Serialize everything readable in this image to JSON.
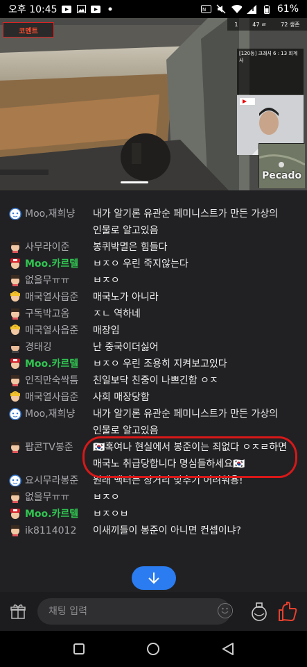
{
  "status_bar": {
    "time": "오후 10:45",
    "battery": "61%"
  },
  "video": {
    "channel_logo": "코멘트",
    "minimap_label": "Pecado",
    "info_panel_text": "[120등] 크래셔 6 : 13 회계사",
    "hud_labels": [
      "1",
      "47 ㄹ",
      "72 생존"
    ]
  },
  "chat": {
    "messages": [
      {
        "avatar": "blue-cat",
        "nick": "Moo,재희냥",
        "highlight": false,
        "text": "내가 알기론 유관순 페미니스트가 만든 가상의 인물로 알고있음"
      },
      {
        "avatar": "face",
        "nick": "사무라이준",
        "highlight": false,
        "text": "봉퀴박멸은 힘들다"
      },
      {
        "avatar": "red-hat",
        "nick": "Moo.카르텔",
        "highlight": true,
        "text": "ㅂㅈㅇ 우린 죽지않는다"
      },
      {
        "avatar": "face",
        "nick": "없을무ㅠㅠ",
        "highlight": false,
        "text": "ㅂㅈㅇ"
      },
      {
        "avatar": "blond",
        "nick": "매국열사읍준",
        "highlight": false,
        "text": "매국노가 아니라"
      },
      {
        "avatar": "face",
        "nick": "구독박고옴",
        "highlight": false,
        "text": "ㅈㄴ 역하네"
      },
      {
        "avatar": "blond",
        "nick": "매국열사읍준",
        "highlight": false,
        "text": "매장임"
      },
      {
        "avatar": "dark",
        "nick": "경태깅",
        "highlight": false,
        "text": "난 중국이더싫어"
      },
      {
        "avatar": "red-hat",
        "nick": "Moo.카르텔",
        "highlight": true,
        "text": "ㅂㅈㅇ 우린 조용히 지켜보고있다"
      },
      {
        "avatar": "face",
        "nick": "인직만숙싹틈",
        "highlight": false,
        "text": "친일보닥 친중이 나쁘긴함 ㅇㅈ"
      },
      {
        "avatar": "blond",
        "nick": "매국열사읍준",
        "highlight": false,
        "text": "사회 매장당함"
      },
      {
        "avatar": "blue-cat",
        "nick": "Moo,재희냥",
        "highlight": false,
        "text": "내가 알기론 유관순 페미니스트가 만든 가상의 인물로 알고있음"
      },
      {
        "avatar": "face",
        "nick": "팝콘TV봉준",
        "highlight": false,
        "text": "🇰🇷혹여나 현실에서 봉준이는 죄없다 ㅇㅈㄹ하면 매국노 취급당합니다 명심들하세요🇰🇷"
      },
      {
        "avatar": "blue-cat",
        "nick": "요시무라봉준",
        "highlight": false,
        "text": "원래 백터는 장거리 맞추기 어려워용!"
      },
      {
        "avatar": "face",
        "nick": "없을무ㅠㅠ",
        "highlight": false,
        "text": "ㅂㅈㅇ"
      },
      {
        "avatar": "red-hat",
        "nick": "Moo.카르텔",
        "highlight": true,
        "text": "ㅂㅈㅇㅂ"
      },
      {
        "avatar": "face",
        "nick": "ik8114012",
        "highlight": false,
        "text": "이새끼들이 봉준이 아니면 컨셉이냐?"
      }
    ]
  },
  "input": {
    "placeholder": "채팅 입력"
  },
  "colors": {
    "highlight_nick": "#31c651",
    "annotation_red": "#d81818",
    "scroll_button": "#2a7cf0"
  },
  "icons": {
    "gift": "gift-icon",
    "emoji": "emoji-icon",
    "bottle": "bottle-icon",
    "star": "star-balloon-icon",
    "scroll": "arrow-down-icon"
  }
}
